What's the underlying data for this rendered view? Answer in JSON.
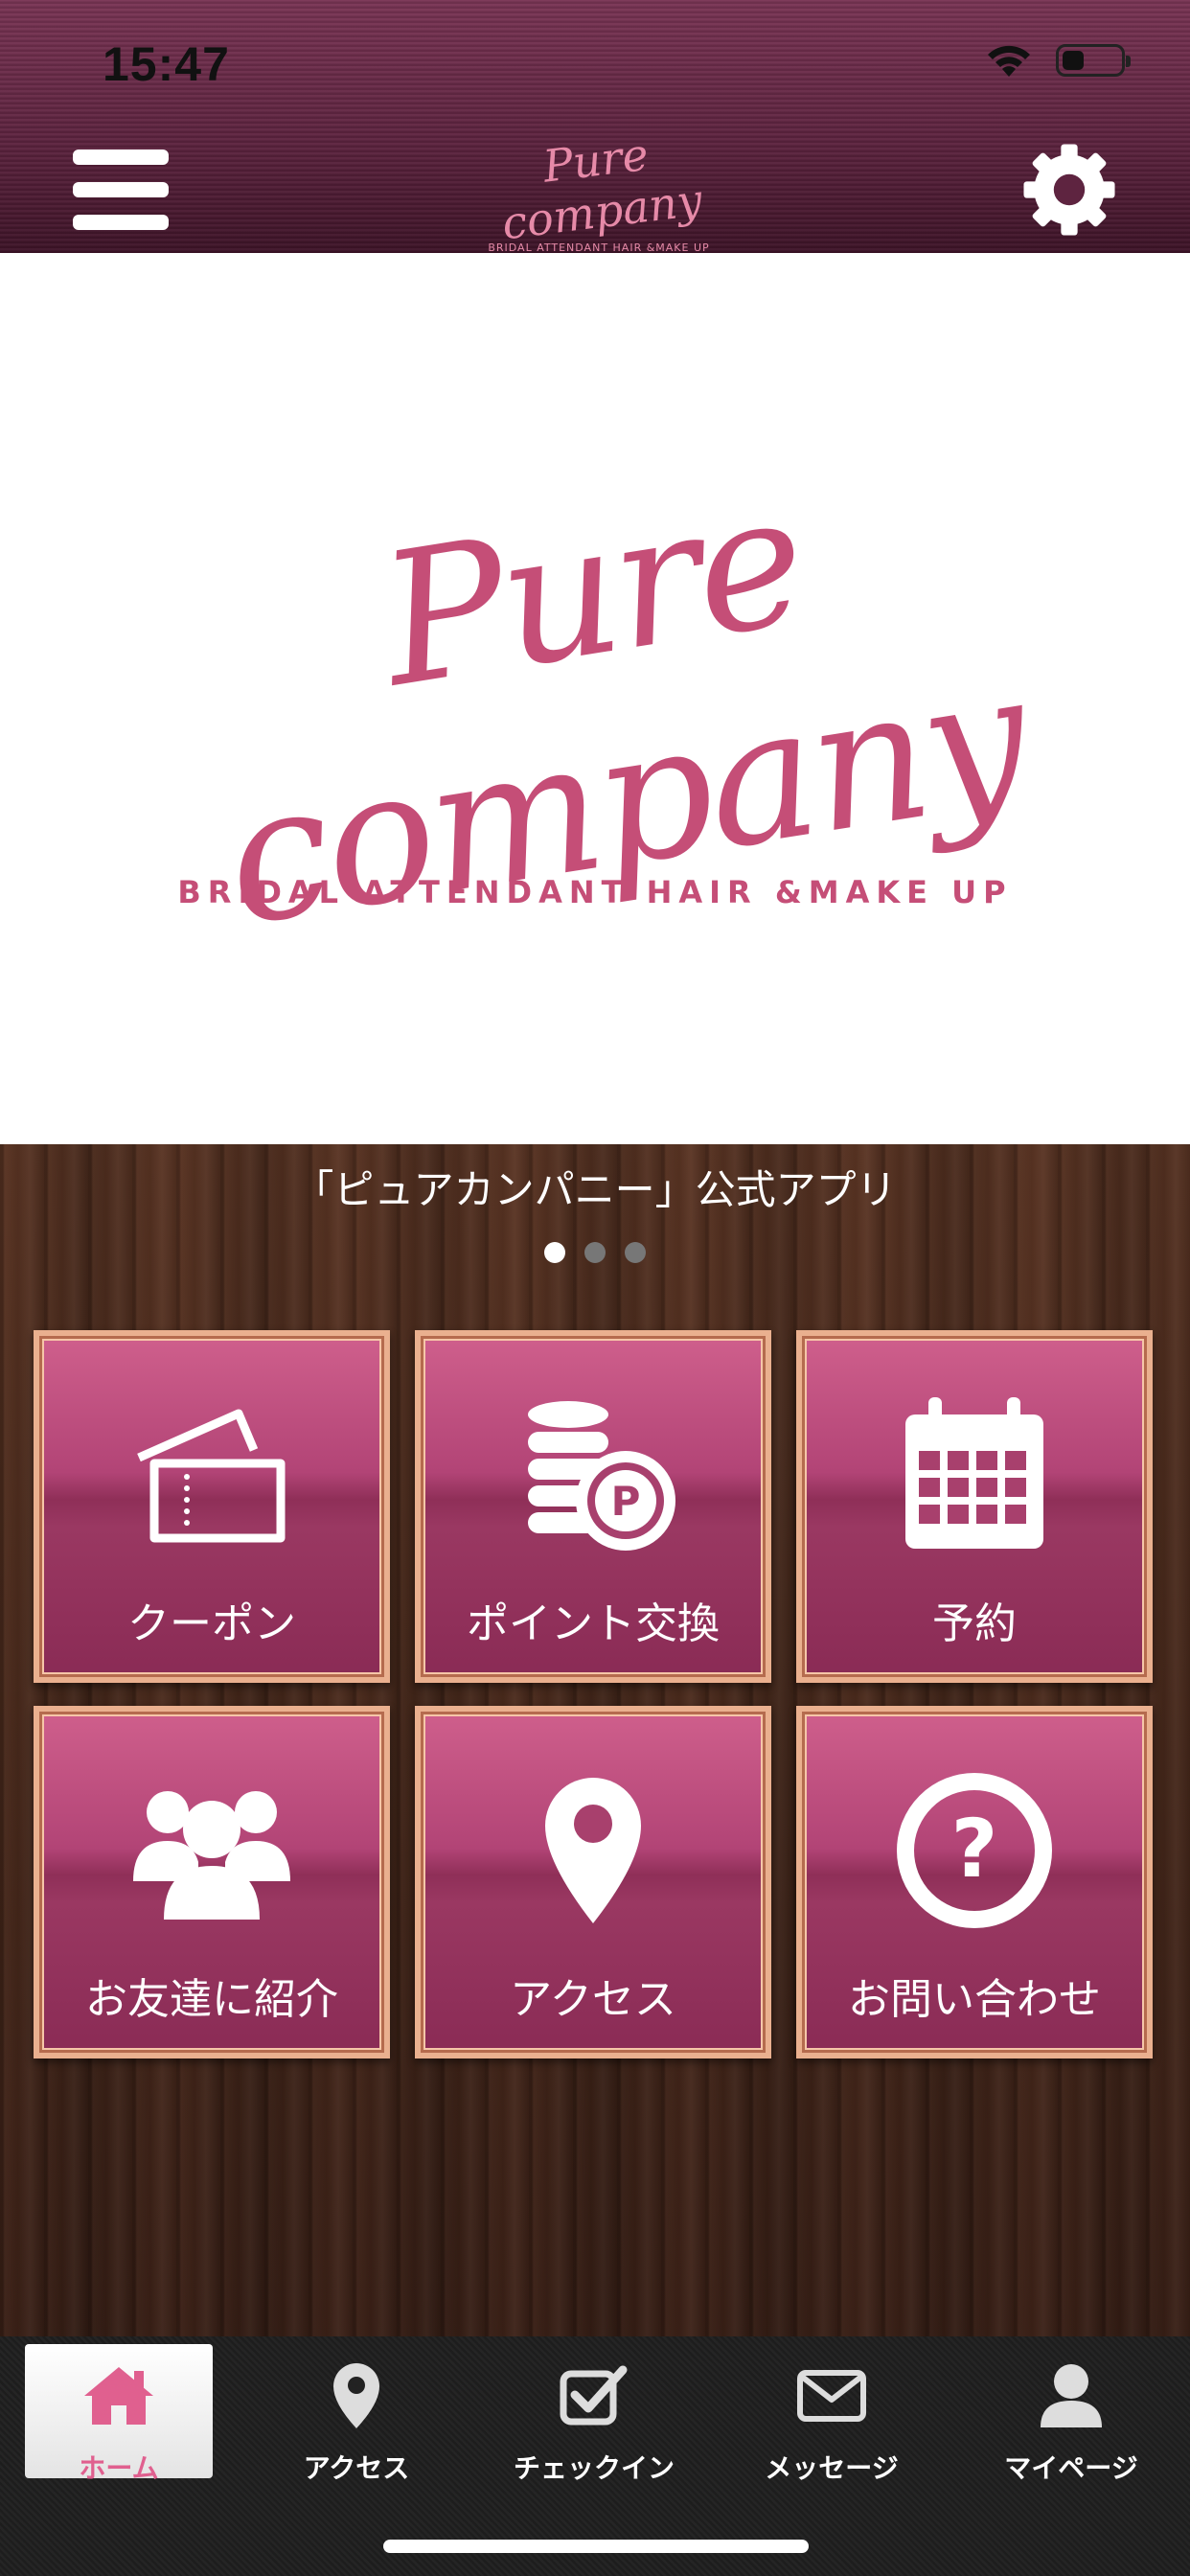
{
  "status_bar": {
    "time": "15:47"
  },
  "header": {
    "logo_script": "Pure company",
    "logo_tagline": "BRIDAL ATTENDANT HAIR &MAKE UP",
    "icons": [
      "menu-icon",
      "gear-icon"
    ]
  },
  "hero": {
    "logo_script": "Pure company",
    "tagline": "BRIDAL ATTENDANT HAIR &MAKE UP"
  },
  "caption": "「ピュアカンパニー」公式アプリ",
  "carousel": {
    "pages": 3,
    "active": 1
  },
  "tiles": [
    {
      "label": "クーポン",
      "icon": "ticket-icon"
    },
    {
      "label": "ポイント交換",
      "icon": "coins-point-icon"
    },
    {
      "label": "予約",
      "icon": "calendar-icon"
    },
    {
      "label": "お友達に紹介",
      "icon": "users-icon"
    },
    {
      "label": "アクセス",
      "icon": "map-pin-icon"
    },
    {
      "label": "お問い合わせ",
      "icon": "question-icon"
    }
  ],
  "tabbar": [
    {
      "label": "ホーム",
      "icon": "home-icon",
      "active": true
    },
    {
      "label": "アクセス",
      "icon": "map-pin-icon"
    },
    {
      "label": "チェックイン",
      "icon": "checkbox-icon"
    },
    {
      "label": "メッセージ",
      "icon": "envelope-icon"
    },
    {
      "label": "マイページ",
      "icon": "person-icon"
    }
  ],
  "colors": {
    "brand_pink": "#c54e77",
    "tile_pink": "#b24476",
    "tile_border": "#eab08f",
    "header_bg": "#5e2440",
    "wood": "#4a2a1c",
    "tab_active_label": "#e0608f"
  }
}
